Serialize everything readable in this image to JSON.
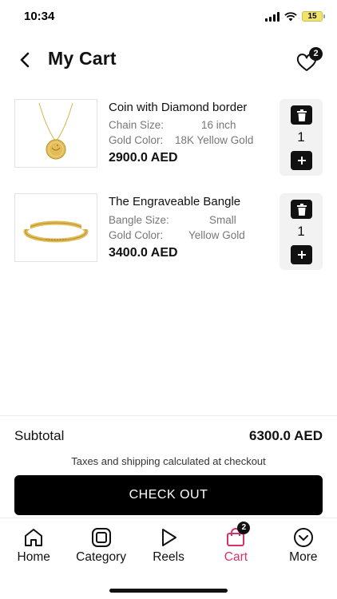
{
  "status_bar": {
    "time": "10:34",
    "battery": "15"
  },
  "header": {
    "title": "My Cart",
    "wishlist_count": "2"
  },
  "cart": {
    "items": [
      {
        "name": "Coin with Diamond border",
        "attrs": [
          {
            "label": "Chain Size:",
            "value": "16 inch"
          },
          {
            "label": "Gold Color:",
            "value": "18K Yellow Gold"
          }
        ],
        "price": "2900.0 AED",
        "quantity": "1"
      },
      {
        "name": "The Engraveable Bangle",
        "attrs": [
          {
            "label": "Bangle Size:",
            "value": "Small"
          },
          {
            "label": "Gold Color:",
            "value": "Yellow Gold"
          }
        ],
        "price": "3400.0 AED",
        "quantity": "1"
      }
    ]
  },
  "summary": {
    "subtotal_label": "Subtotal",
    "subtotal_value": "6300.0 AED",
    "tax_note": "Taxes and shipping calculated at checkout",
    "checkout_label": "CHECK OUT"
  },
  "tabs": [
    {
      "label": "Home",
      "icon": "home-icon"
    },
    {
      "label": "Category",
      "icon": "category-icon"
    },
    {
      "label": "Reels",
      "icon": "play-icon"
    },
    {
      "label": "Cart",
      "icon": "bag-icon",
      "badge": "2",
      "active": true
    },
    {
      "label": "More",
      "icon": "chevron-circle-icon"
    }
  ],
  "colors": {
    "accent": "#d6336c",
    "primary": "#000000",
    "gold": "#d9b24c"
  }
}
